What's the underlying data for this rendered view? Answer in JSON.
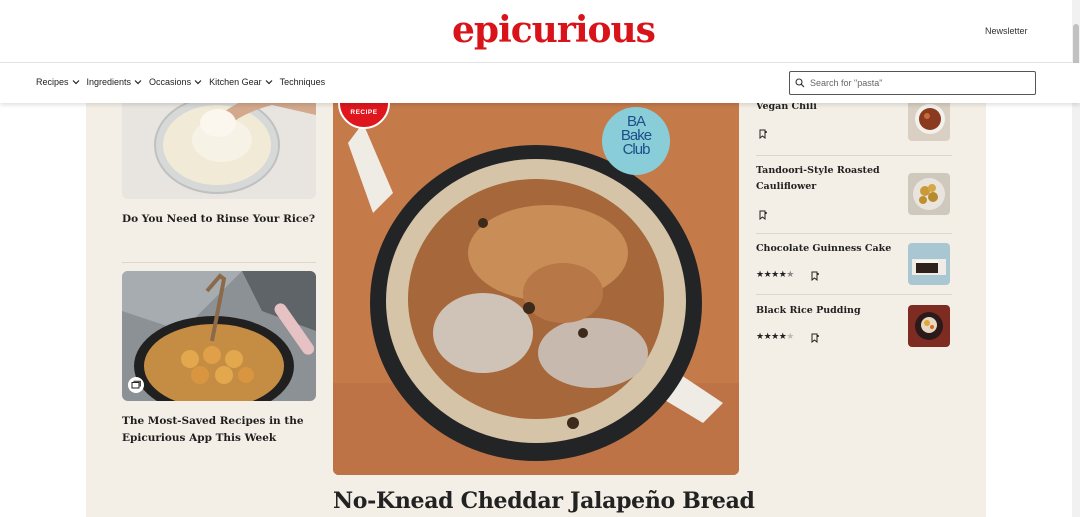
{
  "header": {
    "logo": "epicurious",
    "newsletter_label": "Newsletter"
  },
  "nav": {
    "items": [
      {
        "label": "Recipes",
        "has_dropdown": true
      },
      {
        "label": "Ingredients",
        "has_dropdown": true
      },
      {
        "label": "Occasions",
        "has_dropdown": true
      },
      {
        "label": "Kitchen Gear",
        "has_dropdown": true
      },
      {
        "label": "Techniques",
        "has_dropdown": false
      }
    ],
    "search_placeholder": "Search for \"pasta\""
  },
  "left_column": {
    "cards": [
      {
        "title": "Do You Need to Rinse Your Rice?",
        "icon": "none"
      },
      {
        "title": "The Most-Saved Recipes in the Epicurious App This Week",
        "icon": "gallery-icon"
      }
    ]
  },
  "hero": {
    "badge_label": "RECIPE",
    "partner_logo_lines": [
      "BA",
      "Bake",
      "Club"
    ],
    "title": "No-Knead Cheddar Jalapeño Bread"
  },
  "sidebar": {
    "items": [
      {
        "title": "Vegan Chili",
        "rating": null
      },
      {
        "title": "Tandoori-Style Roasted Cauliflower",
        "rating": null
      },
      {
        "title": "Chocolate Guinness Cake",
        "rating": 4.5
      },
      {
        "title": "Black Rice Pudding",
        "rating": 4
      }
    ]
  },
  "colors": {
    "brand_red": "#d8141a",
    "content_background": "#f4efe6",
    "badge_blue": "#89cdd8"
  }
}
